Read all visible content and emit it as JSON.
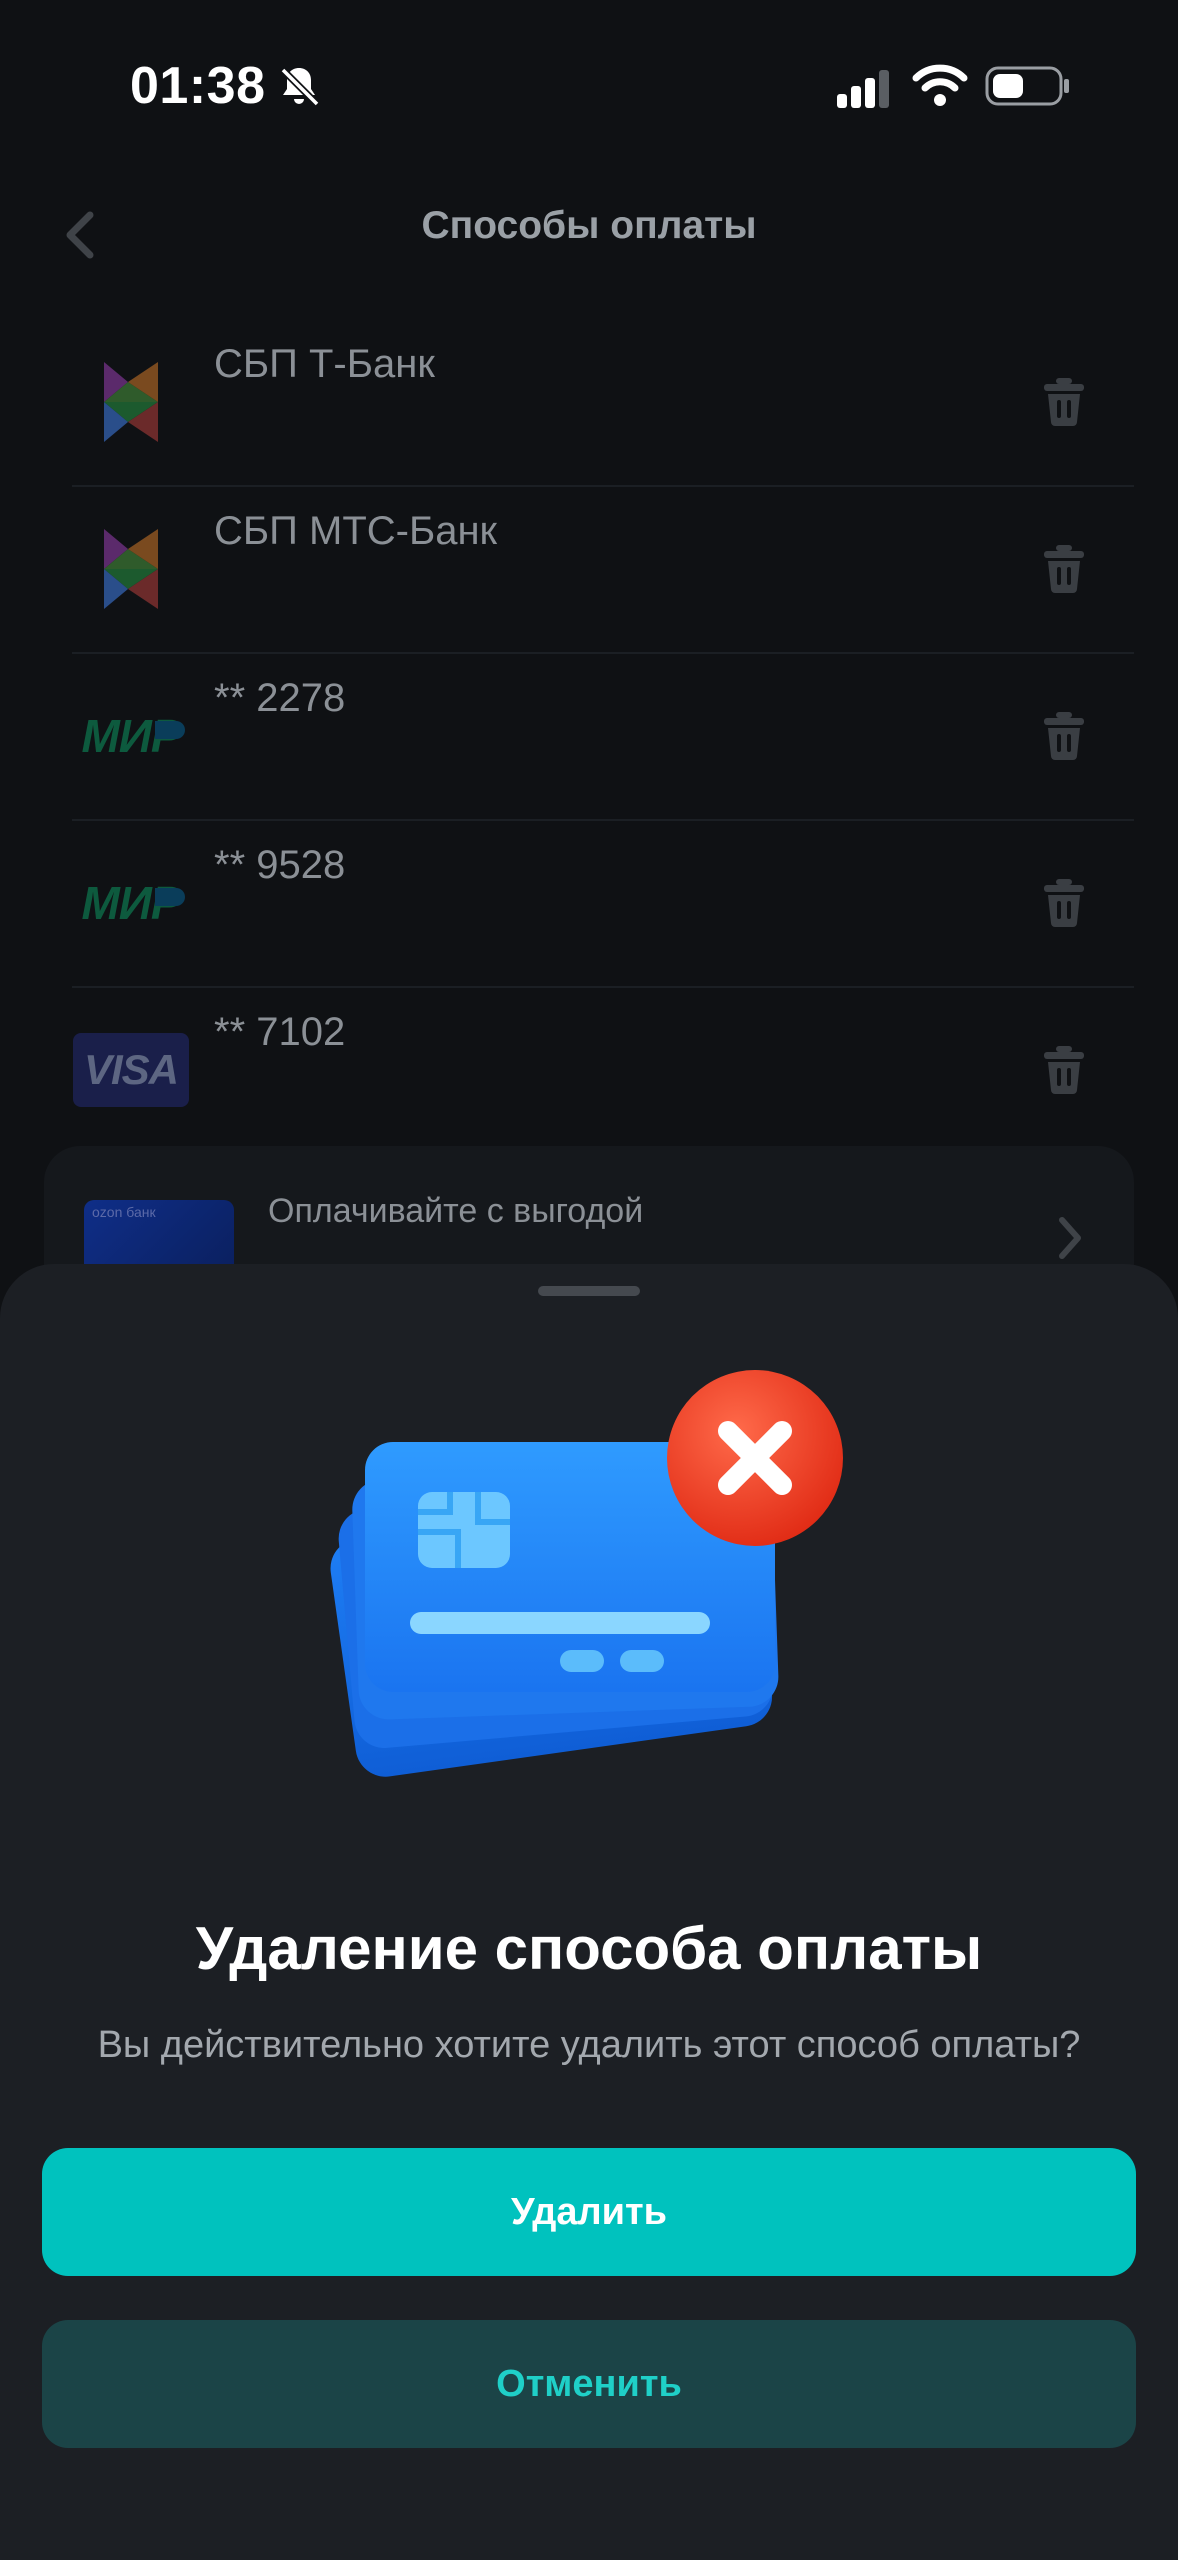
{
  "status_bar": {
    "time": "01:38",
    "icons": [
      "bell-muted-icon",
      "signal-icon",
      "wifi-icon",
      "battery-icon"
    ]
  },
  "header": {
    "title": "Способы оплаты",
    "back_icon": "chevron-left-icon"
  },
  "payment_methods": [
    {
      "label": "СБП Т-Банк",
      "logo": "sbp-logo"
    },
    {
      "label": "СБП МТС-Банк",
      "logo": "sbp-logo"
    },
    {
      "label": "** 2278",
      "logo": "mir-logo"
    },
    {
      "label": "** 9528",
      "logo": "mir-logo"
    },
    {
      "label": "** 7102",
      "logo": "visa-logo"
    }
  ],
  "logos": {
    "mir": "МИР",
    "visa": "VISA"
  },
  "promo": {
    "card_text": "ozon банк",
    "label": "Оплачивайте с выгодой"
  },
  "dialog": {
    "title": "Удаление способа оплаты",
    "subtitle": "Вы действительно хотите удалить этот способ оплаты?",
    "delete_label": "Удалить",
    "cancel_label": "Отменить"
  },
  "colors": {
    "accent": "#00C2BE",
    "cancel_bg": "#1B4447",
    "sheet_bg": "#1C1F24",
    "page_bg": "#0F1114"
  }
}
